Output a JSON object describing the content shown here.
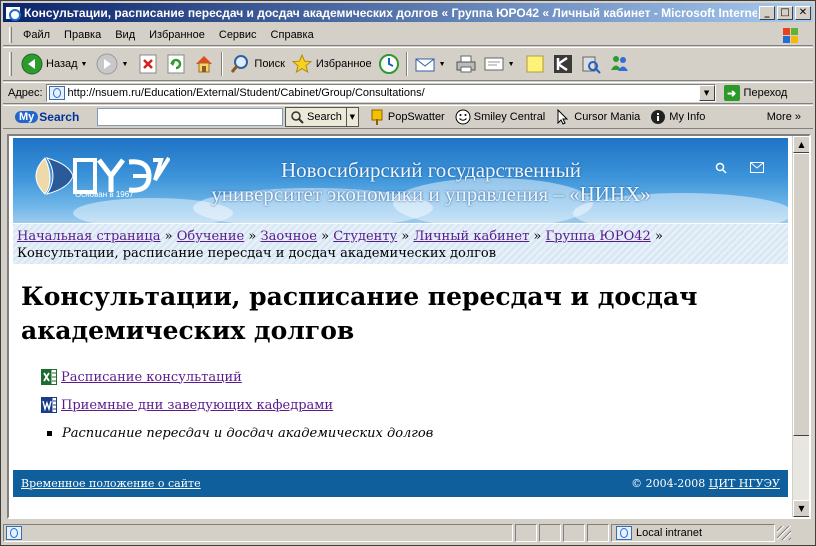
{
  "window": {
    "title": "Консультации, расписание пересдач и досдач академических долгов « Группа ЮРО42 « Личный кабинет - Microsoft Internet Explorer",
    "minimize": "_",
    "maximize": "□",
    "close": "✕"
  },
  "menu": [
    "Файл",
    "Правка",
    "Вид",
    "Избранное",
    "Сервис",
    "Справка"
  ],
  "toolbar": {
    "back": "Назад",
    "search": "Поиск",
    "favorites": "Избранное"
  },
  "address": {
    "label": "Адрес:",
    "url": "http://nsuem.ru/Education/External/Student/Cabinet/Group/Consultations/",
    "go": "Переход"
  },
  "searchbar": {
    "logo_my": "My",
    "logo_rest": "Search",
    "button": "Search",
    "items": [
      "PopSwatter",
      "Smiley Central",
      "Cursor Mania",
      "My Info"
    ],
    "more": "More"
  },
  "page": {
    "since": "Основан в 1967",
    "banner_line1": "Новосибирский государственный",
    "banner_line2": "университет экономики и управления – «НИНХ»",
    "breadcrumbs": [
      "Начальная страница",
      "Обучение",
      "Заочное",
      "Студенту",
      "Личный кабинет",
      "Группа ЮРО42"
    ],
    "breadcrumb_sep": "»",
    "breadcrumb_current": "Консультации, расписание пересдач и досдач академических долгов",
    "heading": "Консультации, расписание пересдач и досдач академических долгов",
    "items": [
      {
        "icon": "excel-icon",
        "label": "Расписание консультаций"
      },
      {
        "icon": "word-icon",
        "label": "Приемные дни заведующих кафедрами"
      }
    ],
    "bullet_item": "Расписание пересдач и досдач академических долгов",
    "footer_left": "Временное положение о сайте",
    "footer_copy": "© 2004-2008",
    "footer_link": "ЦИТ НГУЭУ"
  },
  "status": {
    "zone": "Local intranet"
  }
}
